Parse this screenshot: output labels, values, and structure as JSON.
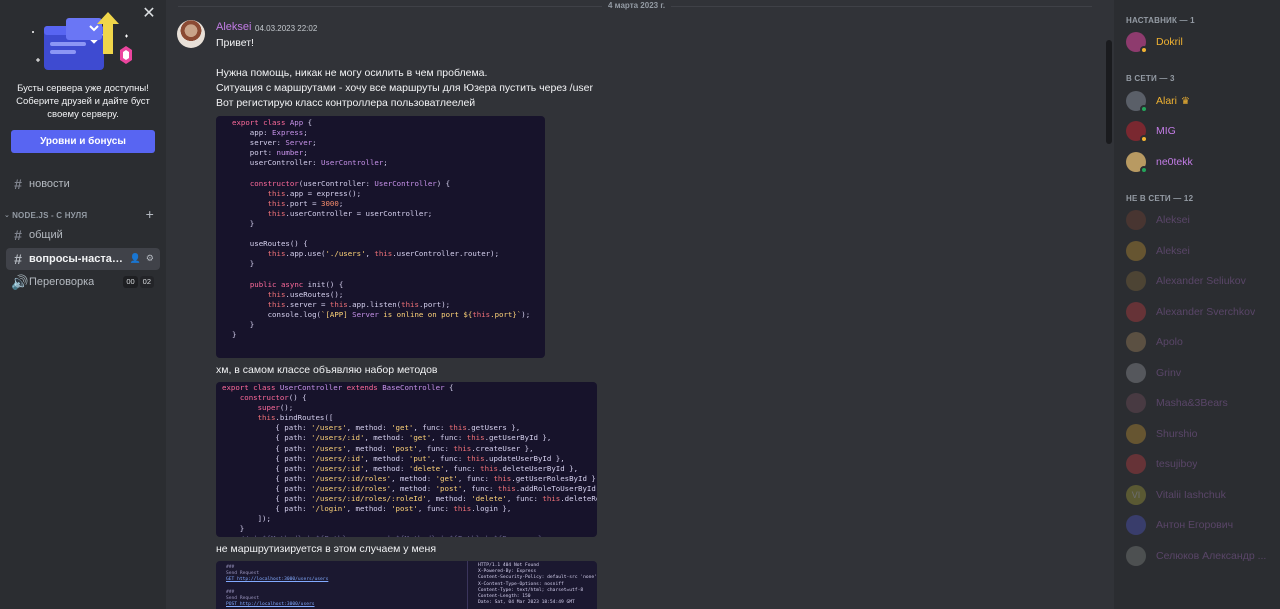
{
  "promo": {
    "close_icon": "close-icon",
    "text": "Бусты сервера уже доступны! Соберите друзей и дайте буст своему серверу.",
    "button_label": "Уровни и бонусы"
  },
  "channels": {
    "news": {
      "name": "новости",
      "icon": "hash-icon"
    },
    "category": {
      "name": "NODE.JS - С НУЛЯ",
      "add_icon": "plus-icon"
    },
    "general": {
      "name": "общий",
      "icon": "hash-icon"
    },
    "qa": {
      "name": "вопросы-наставник",
      "icon": "hash-icon",
      "action_icons": [
        "add-member-icon",
        "gear-icon"
      ]
    },
    "voice": {
      "name": "Переговорка",
      "icon": "speaker-icon",
      "counter_left": "00",
      "counter_right": "02"
    }
  },
  "chat": {
    "date_divider": "4 марта 2023 г.",
    "author": "Aleksei",
    "timestamp": "04.03.2023 22:02",
    "messages": [
      "Привет!",
      "Нужна помощь, никак не могу осилить в чем проблема.",
      "Ситуация с маршрутами - хочу все маршруты для Юзера пустить через /user",
      "Вот регистирую класс контроллера пользоватлеелей",
      "хм, в самом классе объявляю набор методов",
      "не маршрутизируется в этом случаем у меня"
    ],
    "code1": [
      "export class App {",
      "    app: Express;",
      "    server: Server;",
      "    port: number;",
      "    userController: UserController;",
      "",
      "    constructor(userController: UserController) {",
      "        this.app = express();",
      "        this.port = 3000;",
      "        this.userController = userController;",
      "    }",
      "",
      "    useRoutes() {",
      "        this.app.use('./users', this.userController.router);",
      "    }",
      "",
      "    public async init() {",
      "        this.useRoutes();",
      "        this.server = this.app.listen(this.port);",
      "        console.log(`[APP] Server is online on port ${this.port}`);",
      "    }",
      "}",
      ""
    ],
    "code2": [
      "export class UserController extends BaseController {",
      "    constructor() {",
      "        super();",
      "        this.bindRoutes([",
      "            { path: '/users', method: 'get', func: this.getUsers },",
      "            { path: '/users/:id', method: 'get', func: this.getUserById },",
      "            { path: '/users', method: 'post', func: this.createUser },",
      "            { path: '/users/:id', method: 'put', func: this.updateUserById },",
      "            { path: '/users/:id', method: 'delete', func: this.deleteUserById },",
      "            { path: '/users/:id/roles', method: 'get', func: this.getUserRolesById },",
      "            { path: '/users/:id/roles', method: 'post', func: this.addRoleToUserById },",
      "            { path: '/users/:id/roles/:roleId', method: 'delete', func: this.deleteRole",
      "            { path: '/login', method: 'post', func: this.login },",
      "        ]);",
      "    }",
      "    // | ${Method} | ${Path}         | ${Method} | ${Path} | ${Response}"
    ],
    "code3_left": [
      "###",
      "Send Request",
      "GET http://localhost:3000/users/users",
      "",
      "###",
      "Send Request",
      "POST http://localhost:3000/users"
    ],
    "code3_right": [
      "HTTP/1.1 404 Not Found",
      "X-Powered-By: Express",
      "Content-Security-Policy: default-src 'none'",
      "X-Content-Type-Options: nosniff",
      "Content-Type: text/html; charset=utf-8",
      "Content-Length: 150",
      "Date: Sat, 04 Mar 2023 18:54:49 GMT"
    ]
  },
  "members": {
    "groups": [
      {
        "title": "НАСТАВНИК — 1",
        "items": [
          {
            "name": "Dokril",
            "color": "#f0b232",
            "status": "idle",
            "avatar_color": "#8e3b6e"
          }
        ]
      },
      {
        "title": "В СЕТИ — 3",
        "items": [
          {
            "name": "Alari",
            "color": "#f0b232",
            "status": "online",
            "avatar_color": "#5a5f68",
            "badge": "♛"
          },
          {
            "name": "MIG",
            "color": "#c27ce5",
            "status": "idle",
            "avatar_color": "#7a2830"
          },
          {
            "name": "ne0tekk",
            "color": "#c27ce5",
            "status": "online",
            "avatar_color": "#b89a62"
          }
        ]
      },
      {
        "title": "НЕ В СЕТИ — 12",
        "items": [
          {
            "name": "Aleksei",
            "color": "#c27ce5",
            "avatar_color": "#8b4a33"
          },
          {
            "name": "Aleksei",
            "color": "#c27ce5",
            "avatar_color": "#f0b232"
          },
          {
            "name": "Alexander Seliukov",
            "color": "#c27ce5",
            "avatar_color": "#9a7a3a"
          },
          {
            "name": "Alexander Sverchkov",
            "color": "#c27ce5",
            "avatar_color": "#ed4245"
          },
          {
            "name": "Apolo",
            "color": "#c27ce5",
            "avatar_color": "#c9a26b"
          },
          {
            "name": "Grinv",
            "color": "#c27ce5",
            "avatar_color": "#b5bac1"
          },
          {
            "name": "Masha&3Bears",
            "color": "#c27ce5",
            "avatar_color": "#8a5a6a"
          },
          {
            "name": "Shurshio",
            "color": "#c27ce5",
            "avatar_color": "#f0b232"
          },
          {
            "name": "tesujiboy",
            "color": "#c27ce5",
            "avatar_color": "#ed4245"
          },
          {
            "name": "Vitalii Iashchuk",
            "color": "#c27ce5",
            "avatar_color": "#c8c03a",
            "initials": "VI"
          },
          {
            "name": "Антон Егорович",
            "color": "#c27ce5",
            "avatar_color": "#5865f2"
          },
          {
            "name": "Селюков Александр ...",
            "color": "#c27ce5",
            "avatar_color": "#9aa29a"
          }
        ]
      }
    ]
  }
}
